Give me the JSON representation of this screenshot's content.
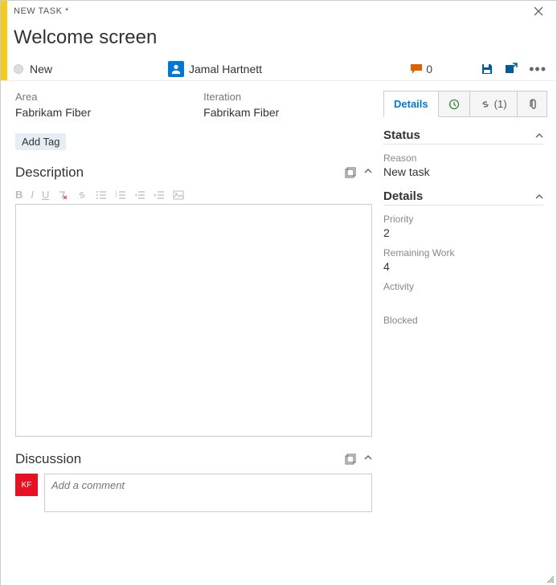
{
  "header": {
    "breadcrumb": "NEW TASK *",
    "title": "Welcome screen"
  },
  "state": {
    "label": "New"
  },
  "assignee": {
    "name": "Jamal Hartnett"
  },
  "comments": {
    "count": "0"
  },
  "fields": {
    "area": {
      "label": "Area",
      "value": "Fabrikam Fiber"
    },
    "iteration": {
      "label": "Iteration",
      "value": "Fabrikam Fiber"
    },
    "add_tag": "Add Tag"
  },
  "sections": {
    "description": "Description",
    "discussion": "Discussion"
  },
  "discussion": {
    "avatar_initials": "KF",
    "placeholder": "Add a comment"
  },
  "tabs": {
    "details": "Details",
    "links_count": "(1)"
  },
  "status_panel": {
    "title": "Status",
    "reason_label": "Reason",
    "reason_value": "New task"
  },
  "details_panel": {
    "title": "Details",
    "priority_label": "Priority",
    "priority_value": "2",
    "remaining_label": "Remaining Work",
    "remaining_value": "4",
    "activity_label": "Activity",
    "blocked_label": "Blocked"
  }
}
